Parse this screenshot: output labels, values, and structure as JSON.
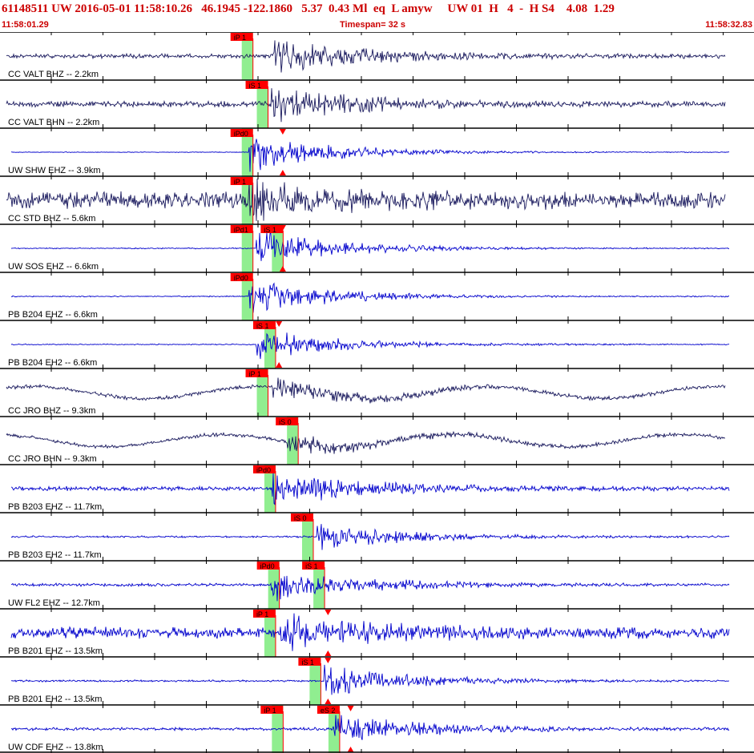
{
  "header": {
    "title": "61148511 UW 2016-05-01 11:58:10.26   46.1945 -122.1860   5.37  0.43 Ml  eq  L amyw     UW 01  H   4  -  H S4    4.08  1.29",
    "start_time": "11:58:01.29",
    "end_time": "11:58:32.83",
    "timespan": "Timespan=  32 s"
  },
  "colors": {
    "header_text": "#cc0000",
    "trace_dark": "#1a1a5e",
    "trace_blue": "#0000cc",
    "pick_box": "#ff0000",
    "phase_band": "#90ee90",
    "grid": "#000000"
  },
  "traces": [
    {
      "label": "CC VALT BHZ -- 2.2km",
      "color": "dark",
      "onset": 0.36,
      "amp": 0.9,
      "noise": 0.12,
      "freq": 2.0,
      "picks": [
        {
          "text": "iP 1",
          "pos": 0.31
        }
      ]
    },
    {
      "label": "CC VALT BHN -- 2.2km",
      "color": "dark",
      "onset": 0.36,
      "amp": 0.9,
      "noise": 0.15,
      "freq": 2.0,
      "picks": [
        {
          "text": "iS 1",
          "pos": 0.33
        }
      ]
    },
    {
      "label": "UW SHW EHZ -- 3.9km",
      "color": "blue",
      "onset": 0.33,
      "amp": 1.0,
      "noise": 0.02,
      "freq": 6.0,
      "picks": [
        {
          "text": "iPd0",
          "pos": 0.31
        }
      ],
      "tri": 0.375
    },
    {
      "label": "CC STD BHZ -- 5.6km",
      "color": "dark",
      "onset": 0.33,
      "amp": 0.7,
      "noise": 0.45,
      "freq": 6.0,
      "picks": [
        {
          "text": "iP 1",
          "pos": 0.31
        }
      ]
    },
    {
      "label": "UW SOS EHZ -- 6.6km",
      "color": "blue",
      "onset": 0.34,
      "amp": 0.9,
      "noise": 0.03,
      "freq": 6.0,
      "picks": [
        {
          "text": "iPd1",
          "pos": 0.31
        },
        {
          "text": "iS 1",
          "pos": 0.35
        }
      ],
      "tri": 0.375
    },
    {
      "label": "PB B204 EHZ -- 6.6km",
      "color": "blue",
      "onset": 0.33,
      "amp": 0.9,
      "noise": 0.03,
      "freq": 6.0,
      "picks": [
        {
          "text": "iPd0",
          "pos": 0.31
        }
      ]
    },
    {
      "label": "PB B204 EH2 -- 6.6km",
      "color": "blue",
      "onset": 0.34,
      "amp": 0.8,
      "noise": 0.03,
      "freq": 6.0,
      "picks": [
        {
          "text": "iS 1",
          "pos": 0.34
        }
      ],
      "tri": 0.37
    },
    {
      "label": "CC JRO BHZ -- 9.3km",
      "color": "dark",
      "onset": 0.36,
      "amp": 0.5,
      "noise": 0.1,
      "freq": 3.0,
      "picks": [
        {
          "text": "iP 1",
          "pos": 0.33
        }
      ],
      "wave": 0.5
    },
    {
      "label": "CC JRO BHN -- 9.3km",
      "color": "dark",
      "onset": 0.38,
      "amp": 0.5,
      "noise": 0.1,
      "freq": 3.0,
      "picks": [
        {
          "text": "iS 0",
          "pos": 0.37
        }
      ],
      "wave": 0.5
    },
    {
      "label": "PB B203 EHZ -- 11.7km",
      "color": "blue",
      "onset": 0.36,
      "amp": 0.9,
      "noise": 0.12,
      "freq": 6.0,
      "picks": [
        {
          "text": "iPd0",
          "pos": 0.34
        }
      ]
    },
    {
      "label": "PB B203 EH2 -- 11.7km",
      "color": "blue",
      "onset": 0.42,
      "amp": 0.7,
      "noise": 0.05,
      "freq": 6.0,
      "picks": [
        {
          "text": "iS 0",
          "pos": 0.39
        }
      ]
    },
    {
      "label": "UW FL2 EHZ -- 12.7km",
      "color": "blue",
      "onset": 0.36,
      "amp": 0.9,
      "noise": 0.08,
      "freq": 6.0,
      "picks": [
        {
          "text": "iPd0",
          "pos": 0.345
        },
        {
          "text": "iS 1",
          "pos": 0.405
        }
      ]
    },
    {
      "label": "PB B201 EHZ -- 13.5km",
      "color": "blue",
      "onset": 0.37,
      "amp": 0.9,
      "noise": 0.3,
      "freq": 3.0,
      "picks": [
        {
          "text": "iP 1",
          "pos": 0.34
        }
      ],
      "tri": 0.435
    },
    {
      "label": "PB B201 EH2 -- 13.5km",
      "color": "blue",
      "onset": 0.43,
      "amp": 0.8,
      "noise": 0.05,
      "freq": 6.0,
      "picks": [
        {
          "text": "iS 1",
          "pos": 0.4
        }
      ],
      "tri": 0.435
    },
    {
      "label": "UW CDF EHZ -- 13.8km",
      "color": "blue",
      "onset": 0.44,
      "amp": 0.8,
      "noise": 0.08,
      "freq": 6.0,
      "picks": [
        {
          "text": "iP 1",
          "pos": 0.35
        },
        {
          "text": "eS 2",
          "pos": 0.425
        }
      ],
      "tri": 0.465
    }
  ]
}
